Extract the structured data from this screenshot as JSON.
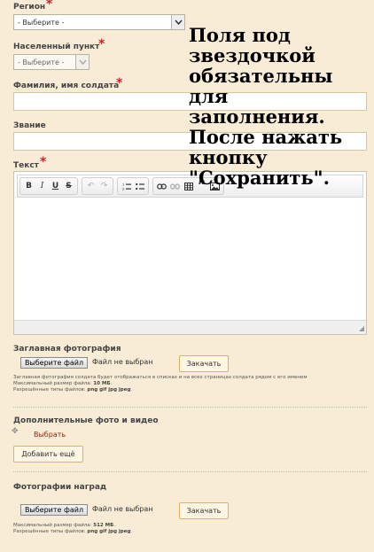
{
  "region": {
    "label": "Регион",
    "required_mark": "*",
    "value": "- Выберите -"
  },
  "locality": {
    "label": "Населенный пункт",
    "required_mark": "*",
    "value": "- Выберите -"
  },
  "soldier_name": {
    "label": "Фамилия, имя солдата",
    "required_mark": "*",
    "value": ""
  },
  "rank": {
    "label": "Звание",
    "value": ""
  },
  "text": {
    "label": "Текст",
    "required_mark": "*",
    "value": ""
  },
  "toolbar": {
    "bold": "B",
    "italic": "I",
    "underline": "U",
    "strike": "S",
    "undo": "↶",
    "redo": "↷",
    "ordered_list": "⋮",
    "bullet_list": "⁝",
    "link": "⚭",
    "unlink": "⚮",
    "table": "▦",
    "quote": "„",
    "image": "▣"
  },
  "main_photo": {
    "title": "Заглавная фотография",
    "choose_label": "Выберите файл",
    "status": "Файл не выбран",
    "upload_label": "Закачать",
    "hint_line1": "Заглавная фотография солдата будет отображаться в списках и на всех страницах солдата рядом с его именем",
    "hint_size_label": "Максимальный размер файла: ",
    "hint_size_value": "10 МБ",
    "hint_types_label": "Разрешённые типы файлов: ",
    "hint_types_value": "png gif jpg jpeg"
  },
  "extra_media": {
    "title": "Дополнительные фото и видео",
    "select_link": "Выбрать",
    "add_more_label": "Добавить ещё"
  },
  "awards_photo": {
    "title": "Фотографии наград",
    "choose_label": "Выберите файл",
    "status": "Файл не выбран",
    "upload_label": "Закачать",
    "hint_size_label": "Максимальный размер файла: ",
    "hint_size_value": "512 МБ",
    "hint_types_label": "Разрешённые типы файлов: ",
    "hint_types_value": "png gif jpg jpeg"
  },
  "overlay_note": "Поля под звездочкой обязательны для заполнения. После нажать кнопку \"Сохранить\".",
  "colors": {
    "background": "#f8ecd6",
    "required": "#c1272d",
    "accent_border": "#d4b36d"
  },
  "icons": {
    "dropdown": "chevron-down-icon",
    "drag": "drag-handle-icon",
    "resize": "resize-grip-icon"
  }
}
